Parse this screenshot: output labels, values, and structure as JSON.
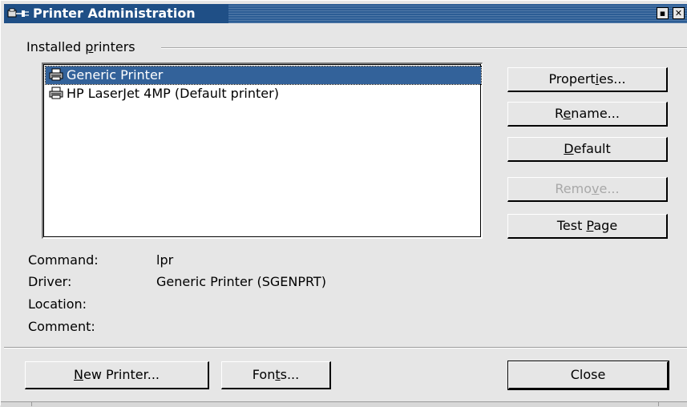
{
  "window": {
    "title": "Printer Administration"
  },
  "group": {
    "label_pre": "Installed ",
    "label_mn": "p",
    "label_post": "rinters"
  },
  "printers": [
    {
      "name": "Generic Printer",
      "selected": true
    },
    {
      "name": "HP LaserJet 4MP (Default printer)",
      "selected": false
    }
  ],
  "buttons": {
    "properties": {
      "pre": "Propert",
      "mn": "i",
      "post": "es..."
    },
    "rename": {
      "pre": "R",
      "mn": "e",
      "post": "name..."
    },
    "default": {
      "pre": "",
      "mn": "D",
      "post": "efault"
    },
    "remove": {
      "pre": "Remo",
      "mn": "v",
      "post": "e..."
    },
    "test_page": {
      "pre": "Test ",
      "mn": "P",
      "post": "age"
    }
  },
  "info": {
    "command_label": "Command:",
    "command_value": "lpr",
    "driver_label": "Driver:",
    "driver_value": "Generic Printer (SGENPRT)",
    "location_label": "Location:",
    "location_value": "",
    "comment_label": "Comment:",
    "comment_value": ""
  },
  "footer": {
    "new_printer": {
      "pre": "",
      "mn": "N",
      "post": "ew Printer..."
    },
    "fonts": {
      "pre": "Fon",
      "mn": "t",
      "post": "s..."
    },
    "close": "Close"
  },
  "icons": {
    "title_icon": "printer-plug-icon",
    "printer_icon": "printer-icon",
    "maximize": "maximize-icon",
    "close": "close-icon"
  }
}
